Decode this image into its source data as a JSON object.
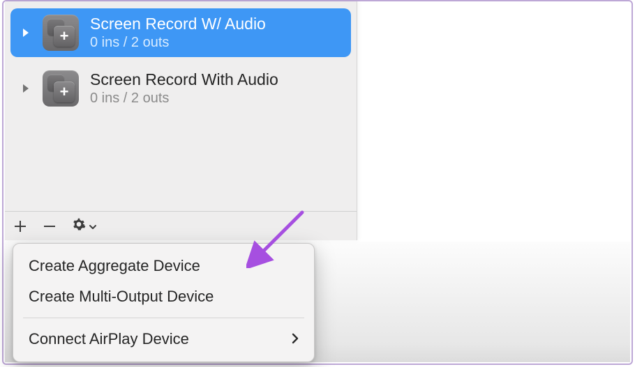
{
  "devices": [
    {
      "name": "Screen Record W/ Audio",
      "sub": "0 ins / 2 outs",
      "selected": true
    },
    {
      "name": "Screen Record With Audio",
      "sub": "0 ins / 2 outs",
      "selected": false
    }
  ],
  "menu": {
    "aggregate": "Create Aggregate Device",
    "multi": "Create Multi-Output Device",
    "airplay": "Connect AirPlay Device"
  },
  "colors": {
    "selection": "#3e97f5",
    "arrow": "#a64fe0"
  }
}
